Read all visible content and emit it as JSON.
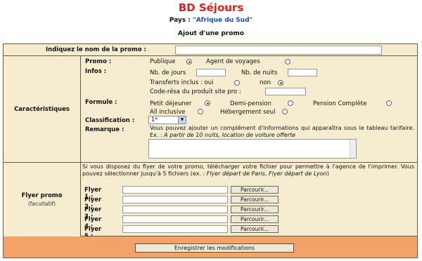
{
  "header": {
    "title": "BD Séjours",
    "pays_label": "Pays : ",
    "pays_value": "\"Afrique du Sud\"",
    "subtitle": "Ajout d'une promo"
  },
  "promo_name": {
    "label": "Indiquez le nom de la promo :",
    "value": ""
  },
  "caracteristiques": {
    "label": "Caractéristiques",
    "promo_label": "Promo :",
    "promo_options": [
      {
        "label": "Publique",
        "selected": true
      },
      {
        "label": "Agent de voyages",
        "selected": false
      }
    ],
    "infos_label": "Infos :",
    "nb_jours_label": "Nb. de jours",
    "nb_nuits_label": "Nb. de nuits",
    "transferts_label": "Transferts inclus : oui",
    "transferts_no": "non",
    "transferts_yes_selected": false,
    "transferts_no_selected": true,
    "code_label": "Code-résa du produit site pro :",
    "formule_label": "Formule :",
    "formule_options": [
      {
        "label": "Petit déjeuner",
        "selected": true
      },
      {
        "label": "Demi-pension",
        "selected": false
      },
      {
        "label": "Pension Complète",
        "selected": false
      },
      {
        "label": "All inclusive",
        "selected": false
      },
      {
        "label": "Hébergement seul",
        "selected": false
      }
    ],
    "classification_label": "Classification :",
    "classification_value": "1*",
    "remarque_label": "Remarque :",
    "remarque_text": "Vous pouvez ajouter un complément d'informations qui apparaîtra sous le tableau tarifaire. Ex. :",
    "remarque_example": "A partir de 10 nuits, location de voiture offerte"
  },
  "flyer": {
    "label": "Flyer promo",
    "sublabel": "(facultatif)",
    "text": "Si vous disposez du flyer de votre promo, télécharger votre fichier pour permettre à l'agence de l'imprimer. Vous pouvez sélectionner jusqu'à 5 fichiers (ex. :",
    "example1": "Flyer départ de Paris",
    "sep": ",",
    "example2": "Flyer départ de Lyon",
    "close": ")",
    "files": [
      {
        "label": "Flyer 1 :",
        "button": "Parcourir..."
      },
      {
        "label": "Flyer 2 :",
        "button": "Parcourir..."
      },
      {
        "label": "Flyer 3 :",
        "button": "Parcourir..."
      },
      {
        "label": "Flyer 4 :",
        "button": "Parcourir..."
      },
      {
        "label": "Flyer 5 :",
        "button": "Parcourir..."
      }
    ]
  },
  "submit_label": "Enregistrer les modifications"
}
